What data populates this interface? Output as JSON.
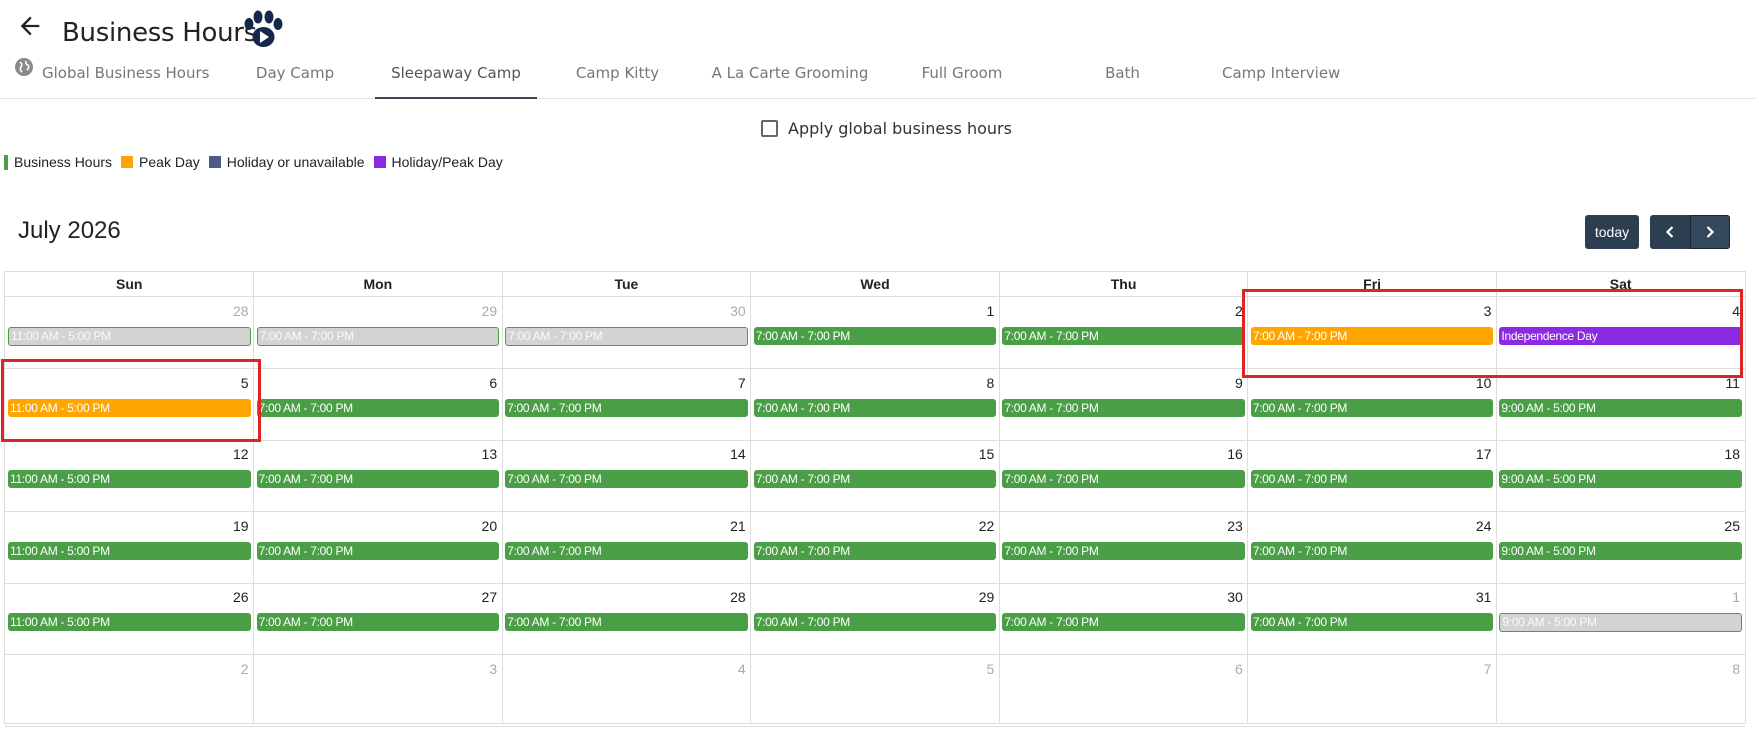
{
  "header": {
    "title": "Business Hours",
    "back_icon": "arrow-left-icon",
    "logo_icon": "paw-play-icon"
  },
  "tabs": [
    {
      "label": "Global Business Hours",
      "icon": "globe-icon",
      "active": false
    },
    {
      "label": "Day Camp",
      "active": false
    },
    {
      "label": "Sleepaway Camp",
      "active": true
    },
    {
      "label": "Camp Kitty",
      "active": false
    },
    {
      "label": "A La Carte Grooming",
      "active": false
    },
    {
      "label": "Full Groom",
      "active": false
    },
    {
      "label": "Bath",
      "active": false
    },
    {
      "label": "Camp Interview",
      "active": false
    }
  ],
  "apply_global": {
    "label": "Apply global business hours",
    "checked": false
  },
  "legend": [
    {
      "label": "Business Hours",
      "color": "#4a9e46"
    },
    {
      "label": "Peak Day",
      "color": "#ffa500"
    },
    {
      "label": "Holiday or unavailable",
      "color": "#4e5a8a"
    },
    {
      "label": "Holiday/Peak Day",
      "color": "#8a2be2"
    }
  ],
  "calendar": {
    "month_label": "July 2026",
    "today_label": "today",
    "prev_icon": "chevron-left-icon",
    "next_icon": "chevron-right-icon",
    "weekdays": [
      "Sun",
      "Mon",
      "Tue",
      "Wed",
      "Thu",
      "Fri",
      "Sat"
    ],
    "weeks": [
      [
        {
          "day": "28",
          "other": true,
          "event": "11:00 AM - 5:00 PM",
          "type": "grey"
        },
        {
          "day": "29",
          "other": true,
          "event": "7:00 AM - 7:00 PM",
          "type": "grey"
        },
        {
          "day": "30",
          "other": true,
          "event": "7:00 AM - 7:00 PM",
          "type": "grey"
        },
        {
          "day": "1",
          "event": "7:00 AM - 7:00 PM",
          "type": "green"
        },
        {
          "day": "2",
          "event": "7:00 AM - 7:00 PM",
          "type": "green"
        },
        {
          "day": "3",
          "event": "7:00 AM - 7:00 PM",
          "type": "orange"
        },
        {
          "day": "4",
          "event": "Independence Day",
          "type": "purple"
        }
      ],
      [
        {
          "day": "5",
          "event": "11:00 AM - 5:00 PM",
          "type": "orange"
        },
        {
          "day": "6",
          "event": "7:00 AM - 7:00 PM",
          "type": "green"
        },
        {
          "day": "7",
          "event": "7:00 AM - 7:00 PM",
          "type": "green"
        },
        {
          "day": "8",
          "event": "7:00 AM - 7:00 PM",
          "type": "green"
        },
        {
          "day": "9",
          "event": "7:00 AM - 7:00 PM",
          "type": "green"
        },
        {
          "day": "10",
          "event": "7:00 AM - 7:00 PM",
          "type": "green"
        },
        {
          "day": "11",
          "event": "9:00 AM - 5:00 PM",
          "type": "green"
        }
      ],
      [
        {
          "day": "12",
          "event": "11:00 AM - 5:00 PM",
          "type": "green"
        },
        {
          "day": "13",
          "event": "7:00 AM - 7:00 PM",
          "type": "green"
        },
        {
          "day": "14",
          "event": "7:00 AM - 7:00 PM",
          "type": "green"
        },
        {
          "day": "15",
          "event": "7:00 AM - 7:00 PM",
          "type": "green"
        },
        {
          "day": "16",
          "event": "7:00 AM - 7:00 PM",
          "type": "green"
        },
        {
          "day": "17",
          "event": "7:00 AM - 7:00 PM",
          "type": "green"
        },
        {
          "day": "18",
          "event": "9:00 AM - 5:00 PM",
          "type": "green"
        }
      ],
      [
        {
          "day": "19",
          "event": "11:00 AM - 5:00 PM",
          "type": "green"
        },
        {
          "day": "20",
          "event": "7:00 AM - 7:00 PM",
          "type": "green"
        },
        {
          "day": "21",
          "event": "7:00 AM - 7:00 PM",
          "type": "green"
        },
        {
          "day": "22",
          "event": "7:00 AM - 7:00 PM",
          "type": "green"
        },
        {
          "day": "23",
          "event": "7:00 AM - 7:00 PM",
          "type": "green"
        },
        {
          "day": "24",
          "event": "7:00 AM - 7:00 PM",
          "type": "green"
        },
        {
          "day": "25",
          "event": "9:00 AM - 5:00 PM",
          "type": "green"
        }
      ],
      [
        {
          "day": "26",
          "event": "11:00 AM - 5:00 PM",
          "type": "green"
        },
        {
          "day": "27",
          "event": "7:00 AM - 7:00 PM",
          "type": "green"
        },
        {
          "day": "28",
          "event": "7:00 AM - 7:00 PM",
          "type": "green"
        },
        {
          "day": "29",
          "event": "7:00 AM - 7:00 PM",
          "type": "green"
        },
        {
          "day": "30",
          "event": "7:00 AM - 7:00 PM",
          "type": "green"
        },
        {
          "day": "31",
          "event": "7:00 AM - 7:00 PM",
          "type": "green"
        },
        {
          "day": "1",
          "other": true,
          "event": "9:00 AM - 5:00 PM",
          "type": "grey"
        }
      ],
      [
        {
          "day": "2",
          "other": true
        },
        {
          "day": "3",
          "other": true
        },
        {
          "day": "4",
          "other": true
        },
        {
          "day": "5",
          "other": true
        },
        {
          "day": "6",
          "other": true
        },
        {
          "day": "7",
          "other": true
        },
        {
          "day": "8",
          "other": true
        }
      ]
    ]
  }
}
